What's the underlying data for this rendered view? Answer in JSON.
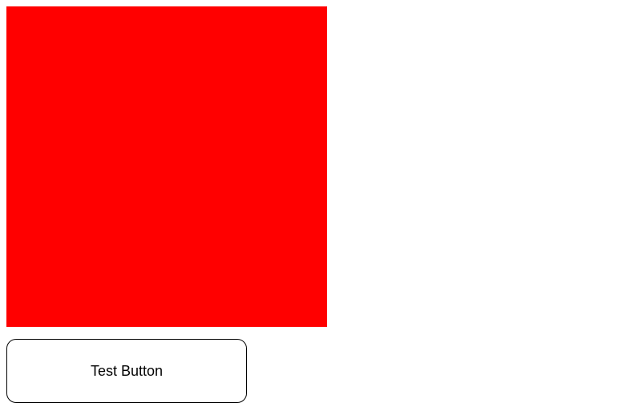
{
  "box": {
    "color": "#ff0000"
  },
  "button": {
    "label": "Test Button"
  }
}
